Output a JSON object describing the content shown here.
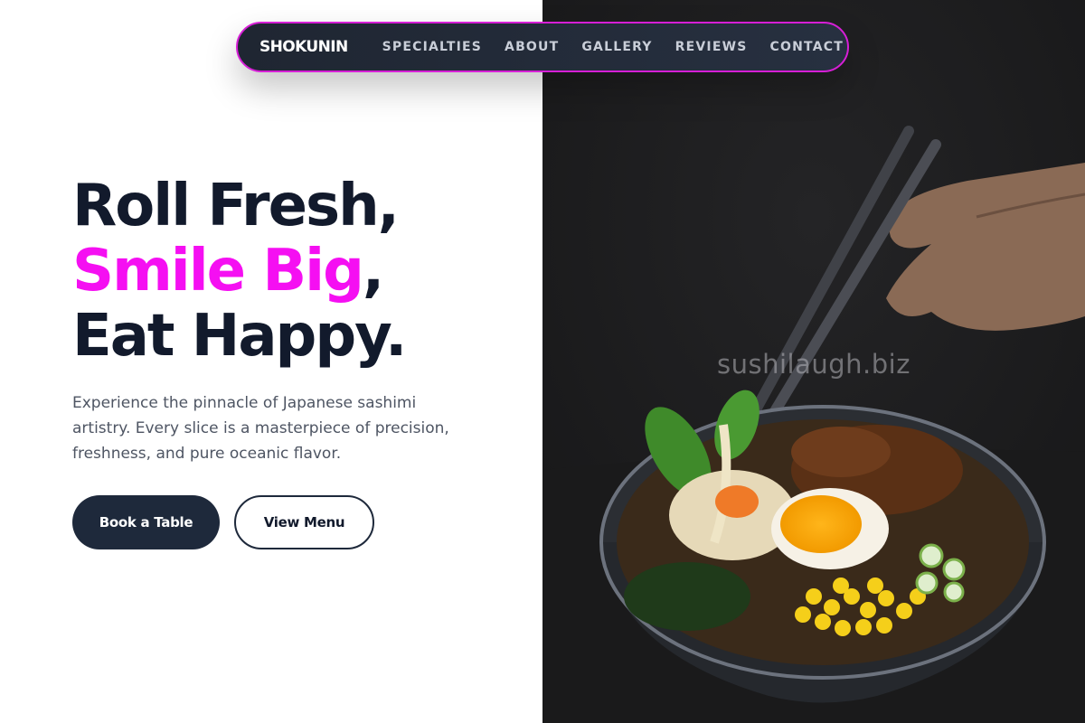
{
  "brand": {
    "logo": "SHOKUNIN"
  },
  "nav": {
    "links": [
      "SPECIALTIES",
      "ABOUT",
      "GALLERY",
      "REVIEWS",
      "CONTACT"
    ]
  },
  "hero": {
    "line1": "Roll Fresh,",
    "line2_accent": "Smile Big",
    "line2_rest": ",",
    "line3": "Eat Happy.",
    "description": "Experience the pinnacle of Japanese sashimi artistry. Every slice is a masterpiece of precision, freshness, and pure oceanic flavor.",
    "primary_button": "Book a Table",
    "secondary_button": "View Menu"
  },
  "image": {
    "watermark": "sushilaugh.biz",
    "icon": "ramen-bowl-photo"
  },
  "colors": {
    "accent": "#f50ff2",
    "dark": "#121a2c",
    "button_dark": "#1e293b",
    "nav_border": "#d61fd6"
  }
}
